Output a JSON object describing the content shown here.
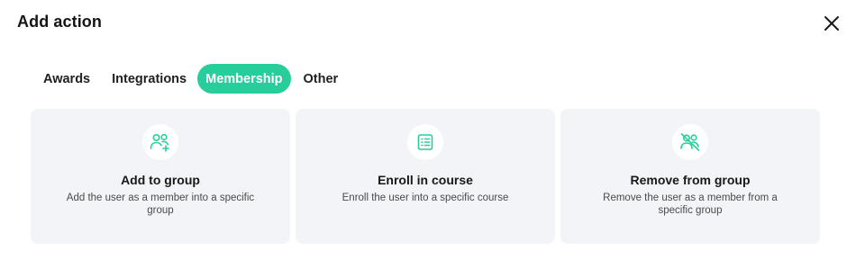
{
  "header": {
    "title": "Add action",
    "close_icon": "close-icon"
  },
  "tabs": [
    {
      "label": "Awards",
      "active": false
    },
    {
      "label": "Integrations",
      "active": false
    },
    {
      "label": "Membership",
      "active": true
    },
    {
      "label": "Other",
      "active": false
    }
  ],
  "cards": [
    {
      "icon": "add-user-group-icon",
      "title": "Add to group",
      "description": "Add the user as a member into a specific group"
    },
    {
      "icon": "course-list-icon",
      "title": "Enroll in course",
      "description": "Enroll the user into a specific course"
    },
    {
      "icon": "remove-user-group-icon",
      "title": "Remove from group",
      "description": "Remove the user as a member from a specific group"
    }
  ],
  "colors": {
    "accent": "#27cd9b",
    "card_background": "#f3f4f7",
    "text_primary": "#181818",
    "text_secondary": "#4a4a4a"
  }
}
